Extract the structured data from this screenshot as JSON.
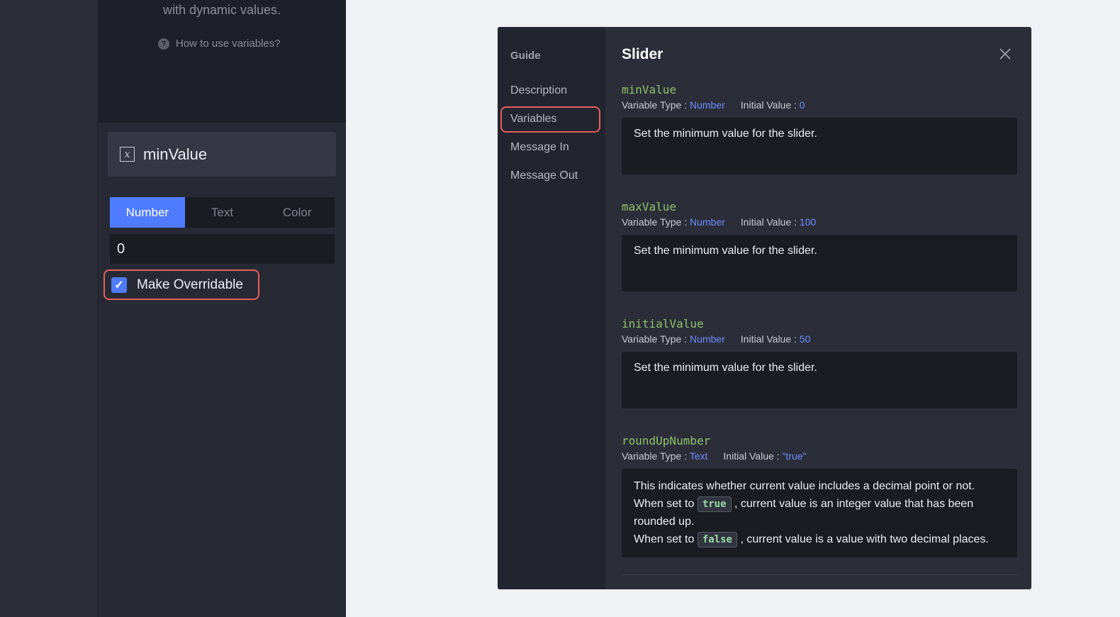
{
  "side_panel": {
    "dynamic_text": "with dynamic values.",
    "help_link": "How to use variables?",
    "variable_name": "minValue",
    "type_tabs": [
      {
        "label": "Number",
        "active": true
      },
      {
        "label": "Text",
        "active": false
      },
      {
        "label": "Color",
        "active": false
      }
    ],
    "value": "0",
    "make_overridable": {
      "label": "Make Overridable",
      "checked": true
    }
  },
  "guide": {
    "nav_title": "Guide",
    "nav_items": [
      {
        "label": "Description",
        "active": false
      },
      {
        "label": "Variables",
        "active": true
      },
      {
        "label": "Message In",
        "active": false
      },
      {
        "label": "Message Out",
        "active": false
      }
    ],
    "title": "Slider",
    "type_label": "Variable Type :",
    "initial_label": "Initial Value :",
    "variables": [
      {
        "name": "minValue",
        "type": "Number",
        "initial": "0",
        "description": "Set the minimum value for the slider."
      },
      {
        "name": "maxValue",
        "type": "Number",
        "initial": "100",
        "description": "Set the minimum value for the slider."
      },
      {
        "name": "initialValue",
        "type": "Number",
        "initial": "50",
        "description": "Set the minimum value for the slider."
      },
      {
        "name": "roundUpNumber",
        "type": "Text",
        "initial": "\"true\"",
        "description_lines": {
          "line1": "This indicates whether current value includes a decimal point or not.",
          "line2_prefix": "When set to",
          "line2_code": "true",
          "line2_suffix": ", current value is an integer value that has been rounded up.",
          "line3_prefix": "When set to",
          "line3_code": "false",
          "line3_suffix": ", current value is a value with two decimal places."
        }
      }
    ]
  },
  "colors": {
    "accent": "#4f7cff",
    "highlight": "#e5605c",
    "var_name": "#8fc26a"
  }
}
